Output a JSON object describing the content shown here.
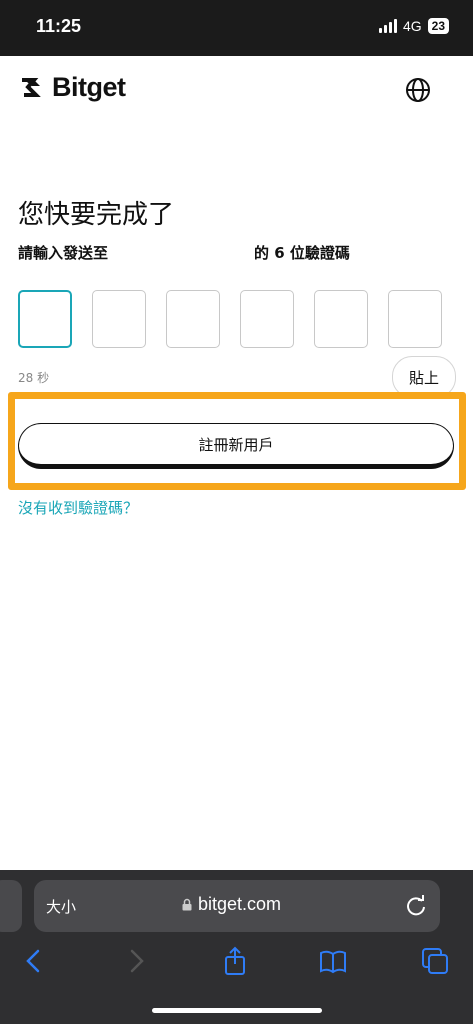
{
  "status_bar": {
    "time": "11:25",
    "network": "4G",
    "battery": "23"
  },
  "header": {
    "brand": "Bitget",
    "language_icon": "globe-icon"
  },
  "page": {
    "title": "您快要完成了",
    "subtitle_prefix": "請輸入發送至",
    "subtitle_suffix": "的 6 位驗證碼"
  },
  "otp": {
    "length": 6,
    "timer": "28 秒",
    "paste_label": "貼上"
  },
  "actions": {
    "register_label": "註冊新用戶",
    "no_code_link": "沒有收到驗證碼？"
  },
  "browser": {
    "text_size": "大小",
    "url": "bitget.com"
  },
  "colors": {
    "accent": "#1aa6b7",
    "highlight": "#f6a61b",
    "browser_bg": "#2f2f31",
    "ios_blue": "#2f7cf6"
  }
}
